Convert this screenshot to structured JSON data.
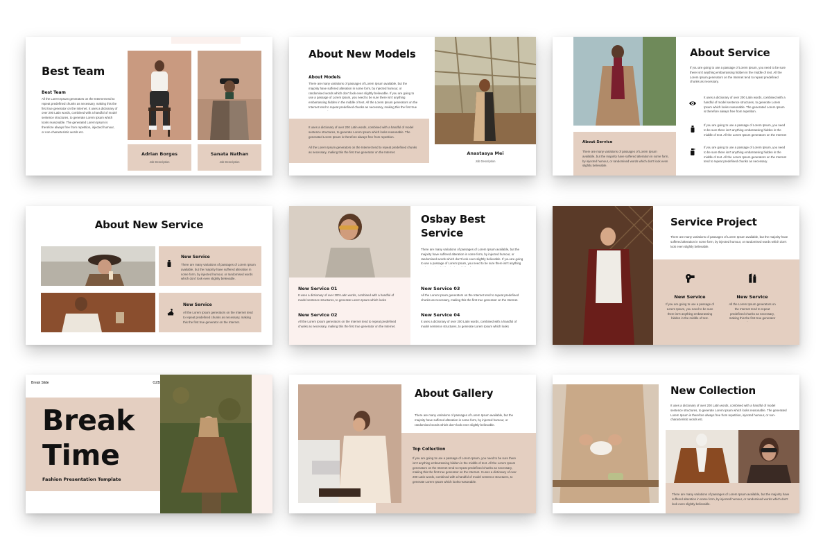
{
  "lorem_a": "There are many variations of passages of Lorem Ipsum available, but the majority have suffered alteration in some form, by injected humour, or randomised words which don't look even slightly believable. If you are going to use a passage of Lorem Ipsum, you need to be sure there isn't anything embarrassing hidden in the middle of text.",
  "lorem_b": "All the Lorem Ipsum generators on the Internet tend to repeat predefined chunks as necessary, making this the first true generator on the Internet. It uses a dictionary of over 200 Latin words, combined with a handful of model sentence structures.",
  "slides": {
    "best_team": {
      "title": "Best Team",
      "subtitle": "Best Team",
      "body": "All the Lorem Ipsum generators on the Internet tend to repeat predefined chunks as necessary, making this the first true generator on the Internet. It uses a dictionary of over 200 Latin words, combined with a handful of model sentence structures, to generate Lorem Ipsum which looks reasonable. The generated Lorem Ipsum is therefore always free from repetition, injected humour, or non-characteristic words etc.",
      "members": [
        {
          "name": "Adrian Borges",
          "role": "Job Description"
        },
        {
          "name": "Sanata Nathan",
          "role": "Job Description"
        }
      ]
    },
    "about_models": {
      "title": "About New Models",
      "subtitle": "About Models",
      "body1": "There are many variations of passages of Lorem Ipsum available, but the majority have suffered alteration in some form, by injected humour, or randomised words which don't look even slightly believable. If you are going to use a passage of Lorem Ipsum, you need to be sure there isn't anything embarrassing hidden in the middle of text. All the Lorem Ipsum generators on the Internet tend to repeat predefined chunks as necessary, making this the first true generator on the Internet.",
      "body2": "It uses a dictionary of over 200 Latin words, combined with a handful of model sentence structures, to generate Lorem Ipsum which looks reasonable. The generated Lorem Ipsum is therefore always free from repetition.",
      "body3": "All the Lorem Ipsum generators on the Internet tend to repeat predefined chunks as necessary, making this the first true generator on the Internet.",
      "model_name": "Anastasya Mei",
      "model_role": "Job Description"
    },
    "about_service": {
      "title": "About Service",
      "intro": "If you are going to use a passage of Lorem Ipsum, you need to be sure there isn't anything embarrassing hidden in the middle of text. All the Lorem Ipsum generators on the Internet tend to repeat predefined chunks as necessary.",
      "items": [
        "It uses a dictionary of over 200 Latin words, combined with a handful of model sentence structures, to generate Lorem Ipsum which looks reasonable. The generated Lorem Ipsum is therefore always free from repetition.",
        "If you are going to use a passage of Lorem Ipsum, you need to be sure there isn't anything embarrassing hidden in the middle of text. All the Lorem Ipsum generators on the Internet tend to repeat.",
        "If you are going to use a passage of Lorem Ipsum, you need to be sure there isn't anything embarrassing hidden in the middle of text. All the Lorem Ipsum generators on the Internet tend to repeat predefined chunks as necessary."
      ],
      "box_title": "About Service",
      "box_body": "There are many variations of passages of Lorem Ipsum available, but the majority have suffered alteration in some form, by injected humour, or randomised words which don't look even slightly believable."
    },
    "about_new_service": {
      "title": "About New Service",
      "items": [
        {
          "title": "New Service",
          "body": "There are many variations of passages of Lorem Ipsum available, but the majority have suffered alteration in some form, by injected humour, or randomised words which don't look even slightly believable."
        },
        {
          "title": "New Service",
          "body": "All the Lorem Ipsum generators on the Internet tend to repeat predefined chunks as necessary, making this the first true generator on the Internet."
        }
      ]
    },
    "osbay_best": {
      "title_line1": "Osbay Best",
      "title_line2": "Service",
      "intro": "There are many variations of passages of Lorem Ipsum available, but the majority have suffered alteration in some form, by injected humour, or randomised words which don't look even slightly believable. If you are going to use a passage of Lorem Ipsum, you need to be sure there isn't anything embarrassing hidden in the middle of text.",
      "services": [
        {
          "title": "New Service 01",
          "body": "It uses a dictionary of over 200 Latin words, combined with a handful of model sentence structures, to generate Lorem Ipsum which looks reasonable."
        },
        {
          "title": "New Service 03",
          "body": "All the Lorem Ipsum generators on the Internet tend to repeat predefined chunks as necessary, making this the first true generator on the Internet."
        },
        {
          "title": "New Service 02",
          "body": "All the Lorem Ipsum generators on the Internet tend to repeat predefined chunks as necessary, making this the first true generator on the Internet."
        },
        {
          "title": "New Service 04",
          "body": "It uses a dictionary of over 200 Latin words, combined with a handful of model sentence structures, to generate Lorem Ipsum which looks reasonable."
        }
      ]
    },
    "service_project": {
      "title": "Service Project",
      "intro": "There are many variations of passages of Lorem Ipsum available, but the majority have suffered alteration in some form, by injected humour, or randomised words which don't look even slightly believable.",
      "items": [
        {
          "title": "New Service",
          "body": "If you are going to use a passage of Lorem Ipsum, you need to be sure there isn't anything embarrassing hidden in the middle of text."
        },
        {
          "title": "New Service",
          "body": "All the Lorem Ipsum generators on the Internet tend to repeat predefined chunks as necessary, making this the first true generator on the Internet."
        }
      ]
    },
    "break": {
      "label": "Break Slide",
      "brand": "OZBAY",
      "title_line1": "Break",
      "title_line2": "Time",
      "subtitle": "Fashion Presentation Template"
    },
    "gallery": {
      "title": "About Gallery",
      "intro": "There are many variations of passages of Lorem Ipsum available, but the majority have suffered alteration in some form, by injected humour, or randomised words which don't look even slightly believable.",
      "box_title": "Top Collection",
      "box_body": "If you are going to use a passage of Lorem Ipsum, you need to be sure there isn't anything embarrassing hidden in the middle of text. All the Lorem Ipsum generators on the Internet tend to repeat predefined chunks as necessary, making this the first true generator on the Internet. It uses a dictionary of over 200 Latin words, combined with a handful of model sentence structures, to generate Lorem Ipsum which looks reasonable."
    },
    "collection": {
      "title": "New Collection",
      "intro": "It uses a dictionary of over 200 Latin words, combined with a handful of model sentence structures, to generate Lorem Ipsum which looks reasonable. The generated Lorem Ipsum is therefore always free from repetition, injected humour, or non-characteristic words etc.",
      "bottom": "There are many variations of passages of Lorem Ipsum available, but the majority have suffered alteration in some form, by injected humour, or randomised words which don't look even slightly believable."
    }
  },
  "icons": {
    "eye": "eye-icon",
    "bottle": "bottle-icon",
    "spray": "spray-bottle-icon",
    "hanger": "hanger-icon",
    "dryer": "hair-dryer-icon",
    "lipstick": "lipstick-icon"
  },
  "colors": {
    "beige": "#e4cfc1",
    "pink": "#fbf1ee",
    "ink": "#111111"
  }
}
